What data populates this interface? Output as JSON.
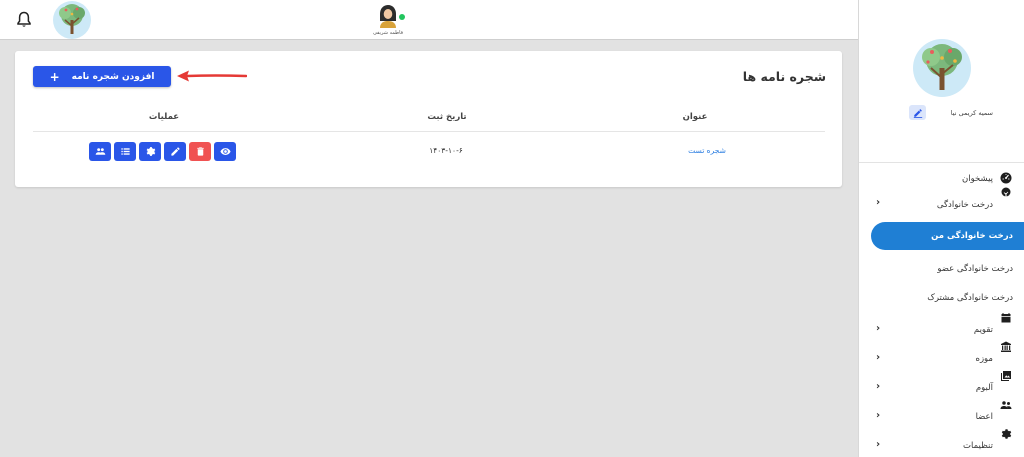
{
  "header": {
    "user_name": "فاطمه شریفی",
    "icons": {
      "notifications": "bell-icon",
      "logo": "family-tree-logo",
      "avatar": "user-avatar"
    }
  },
  "card": {
    "title": "شجره نامه ها",
    "add_button_label": "افزودن شجره نامه",
    "add_button_icon": "+",
    "columns": {
      "title": "عنوان",
      "date": "تاریخ ثبت",
      "actions": "عملیات"
    },
    "rows": [
      {
        "title": "شجره تست",
        "date": "۱۴۰۳-۱۰-۶"
      }
    ],
    "action_icons": [
      "group-icon",
      "list-icon",
      "settings-icon",
      "edit-icon",
      "delete-icon",
      "view-icon"
    ]
  },
  "sidebar": {
    "profile_name": "سمیه کریمی نیا",
    "items": [
      {
        "label": "پیشخوان",
        "icon": "dashboard-icon",
        "expandable": false
      },
      {
        "label": "درخت خانوادگی",
        "icon": "tree-icon",
        "expandable": true
      },
      {
        "label": "درخت خانوادگی من",
        "active": true
      },
      {
        "label": "درخت خانوادگی عضو"
      },
      {
        "label": "درخت خانوادگی مشترک"
      },
      {
        "label": "تقویم",
        "icon": "calendar-icon",
        "expandable": true
      },
      {
        "label": "موزه",
        "icon": "museum-icon",
        "expandable": true
      },
      {
        "label": "آلبوم",
        "icon": "album-icon",
        "expandable": true
      },
      {
        "label": "اعضا",
        "icon": "members-icon",
        "expandable": true
      },
      {
        "label": "تنظیمات",
        "icon": "settings-icon",
        "expandable": true
      }
    ]
  },
  "colors": {
    "primary": "#2a56e8",
    "danger": "#f05252",
    "active_nav": "#1f7fd4",
    "link": "#2a7de1",
    "arrow": "#e53935",
    "online": "#22c55e"
  }
}
